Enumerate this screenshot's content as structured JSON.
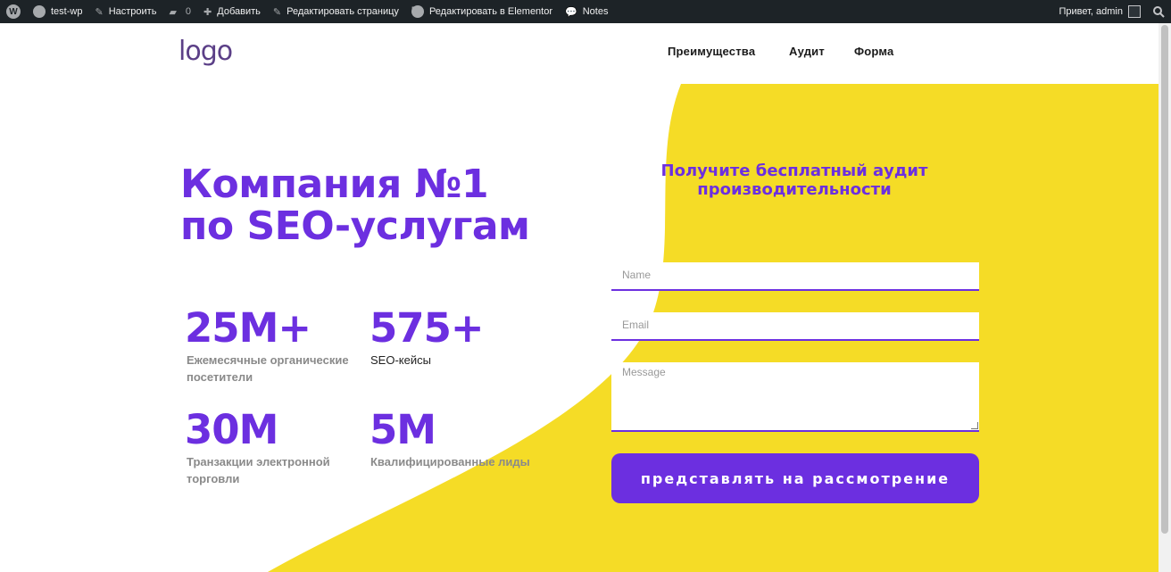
{
  "adminbar": {
    "site_name": "test-wp",
    "customize": "Настроить",
    "comments_count": "0",
    "add_new": "Добавить",
    "edit_page": "Редактировать страницу",
    "edit_elementor": "Редактировать в Elementor",
    "notes": "Notes",
    "greeting": "Привет, admin"
  },
  "header": {
    "logo": "logo",
    "nav": [
      "Преимущества",
      "Аудит",
      "Форма"
    ]
  },
  "hero": {
    "title_line1": "Компания №1",
    "title_line2": "по SEO-услугам"
  },
  "stats": [
    {
      "value": "25M+",
      "label": "Ежемесячные органические посетители"
    },
    {
      "value": "575+",
      "label": "SEO-кейсы"
    },
    {
      "value": "30M",
      "label": "Транзакции электронной торговли"
    },
    {
      "value": "5M",
      "label": "Квалифицированные лиды"
    }
  ],
  "form": {
    "title": "Получите бесплатный аудит производительности",
    "name_placeholder": "Name",
    "email_placeholder": "Email",
    "message_placeholder": "Message",
    "submit": "представлять на рассмотрение"
  },
  "colors": {
    "accent": "#6c2fe0",
    "yellow": "#f5dc26",
    "adminbar": "#1d2327"
  }
}
